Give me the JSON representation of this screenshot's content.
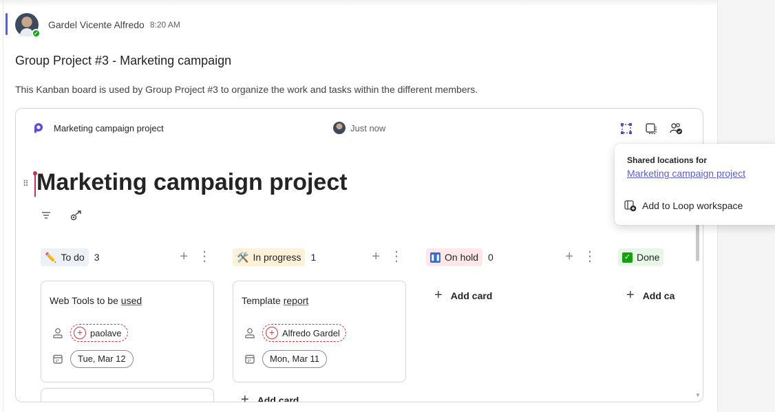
{
  "message": {
    "sender": "Gardel Vicente Alfredo",
    "time": "8:20 AM",
    "title": "Group Project #3 - Marketing campaign",
    "body": "This Kanban board is used by Group Project #3 to organize the work and tasks within the different members."
  },
  "loop": {
    "component_name": "Marketing campaign project",
    "presence_text": "Just now",
    "doc_title": "Marketing campaign project",
    "toolbar_icons": [
      "selection-icon",
      "copy-component-icon",
      "shared-people-icon"
    ],
    "view_icons": [
      "filter-icon",
      "assign-icon"
    ]
  },
  "board": {
    "columns": [
      {
        "emoji": "✏️",
        "label": "To do",
        "count": "3",
        "color": "#e8ebfa"
      },
      {
        "emoji": "🛠️",
        "label": "In progress",
        "count": "1",
        "color": "#fdf1d8"
      },
      {
        "emoji": "⏸",
        "label": "On hold",
        "count": "0",
        "color": "#fde7e9"
      },
      {
        "emoji": "✅",
        "label": "Done",
        "count": "",
        "color": "#e7f6e7"
      }
    ],
    "cards": [
      {
        "title_plain": "Web Tools to be ",
        "title_underlined": "used",
        "assignee": "paolave",
        "date": "Tue, Mar 12"
      },
      {
        "title_plain": "Template ",
        "title_underlined": "report",
        "assignee": "Alfredo Gardel",
        "date": "Mon, Mar 11"
      }
    ],
    "add_card_label": "Add card",
    "add_card_truncated": "Add ca",
    "add_card_bottom_partial": "Add card"
  },
  "popover": {
    "heading": "Shared locations for",
    "link": "Marketing campaign project",
    "action": "Add to Loop workspace"
  }
}
